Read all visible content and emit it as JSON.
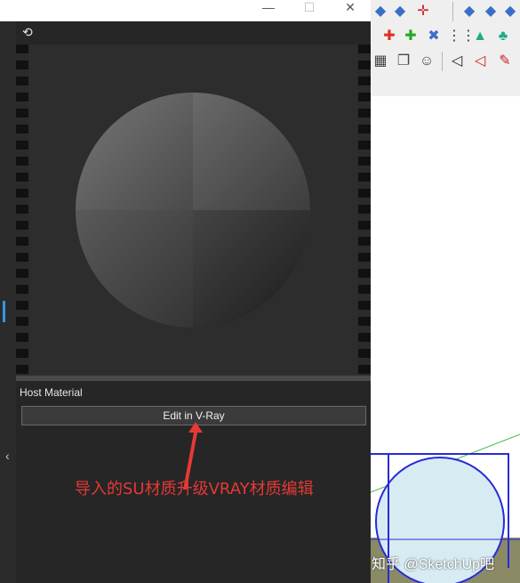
{
  "window": {
    "minimize_glyph": "—",
    "maximize_glyph": "☐",
    "close_glyph": "✕"
  },
  "panel": {
    "header_icon": "camera-rotate-icon",
    "host_material_label": "Host Material",
    "edit_button_label": "Edit in V-Ray"
  },
  "annotation": {
    "text": "导入的SU材质升级VRAY材质编辑",
    "color": "#e53935"
  },
  "sidebar": {
    "collapse_glyph": "‹"
  },
  "watermark": {
    "text": "知乎 @SketchUp吧"
  },
  "toolbar": {
    "row1": [
      "box-icon",
      "box-icon",
      "move-icon",
      "box-icon",
      "box-icon",
      "box-icon"
    ],
    "row2": [
      "move-red-icon",
      "move-green-icon",
      "rotate-icon",
      "grid-icon",
      "cone-icon",
      "tree-icon"
    ],
    "row3": [
      "grid-icon",
      "layers-icon",
      "person-icon",
      "arrow-icon",
      "lock-icon",
      "pen-icon"
    ]
  },
  "colors": {
    "panel_bg": "#262626",
    "accent": "#2f9ae0",
    "annotation": "#e53935"
  }
}
